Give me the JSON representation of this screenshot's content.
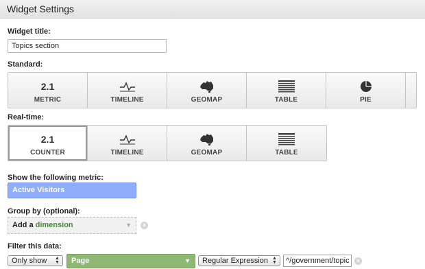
{
  "window": {
    "title": "Widget Settings"
  },
  "widget_title": {
    "label": "Widget title:",
    "value": "Topics section"
  },
  "standard": {
    "label": "Standard:",
    "tiles": [
      {
        "name": "metric",
        "top": "2.1",
        "label": "METRIC",
        "icon": "number-icon",
        "selected": false
      },
      {
        "name": "timeline",
        "top": "",
        "label": "TIMELINE",
        "icon": "line-graph-icon",
        "selected": false
      },
      {
        "name": "geomap",
        "top": "",
        "label": "GEOMAP",
        "icon": "australia-map-icon",
        "selected": false
      },
      {
        "name": "table",
        "top": "",
        "label": "TABLE",
        "icon": "table-lines-icon",
        "selected": false
      },
      {
        "name": "pie",
        "top": "",
        "label": "PIE",
        "icon": "pie-chart-icon",
        "selected": false
      }
    ]
  },
  "realtime": {
    "label": "Real-time:",
    "tiles": [
      {
        "name": "counter",
        "top": "2.1",
        "label": "COUNTER",
        "icon": "number-icon",
        "selected": true
      },
      {
        "name": "timeline",
        "top": "",
        "label": "TIMELINE",
        "icon": "line-graph-icon",
        "selected": false
      },
      {
        "name": "geomap",
        "top": "",
        "label": "GEOMAP",
        "icon": "australia-map-icon",
        "selected": false
      },
      {
        "name": "table",
        "top": "",
        "label": "TABLE",
        "icon": "table-lines-icon",
        "selected": false
      }
    ]
  },
  "metric": {
    "label": "Show the following metric:",
    "value": "Active Visitors",
    "color": "#8fadfb"
  },
  "group_by": {
    "label": "Group by (optional):",
    "prefix": "Add a",
    "highlight": "dimension",
    "highlight_color": "#4b8a3c"
  },
  "filter": {
    "label": "Filter this data:",
    "mode": "Only show",
    "dimension": "Page",
    "dimension_color": "#8fb874",
    "match_type": "Regular Expression",
    "expression": "^/government/topic"
  },
  "icons": {
    "remove": "remove-x-icon",
    "caret": "caret-down-icon",
    "stepper": "up-down-stepper-icon"
  }
}
